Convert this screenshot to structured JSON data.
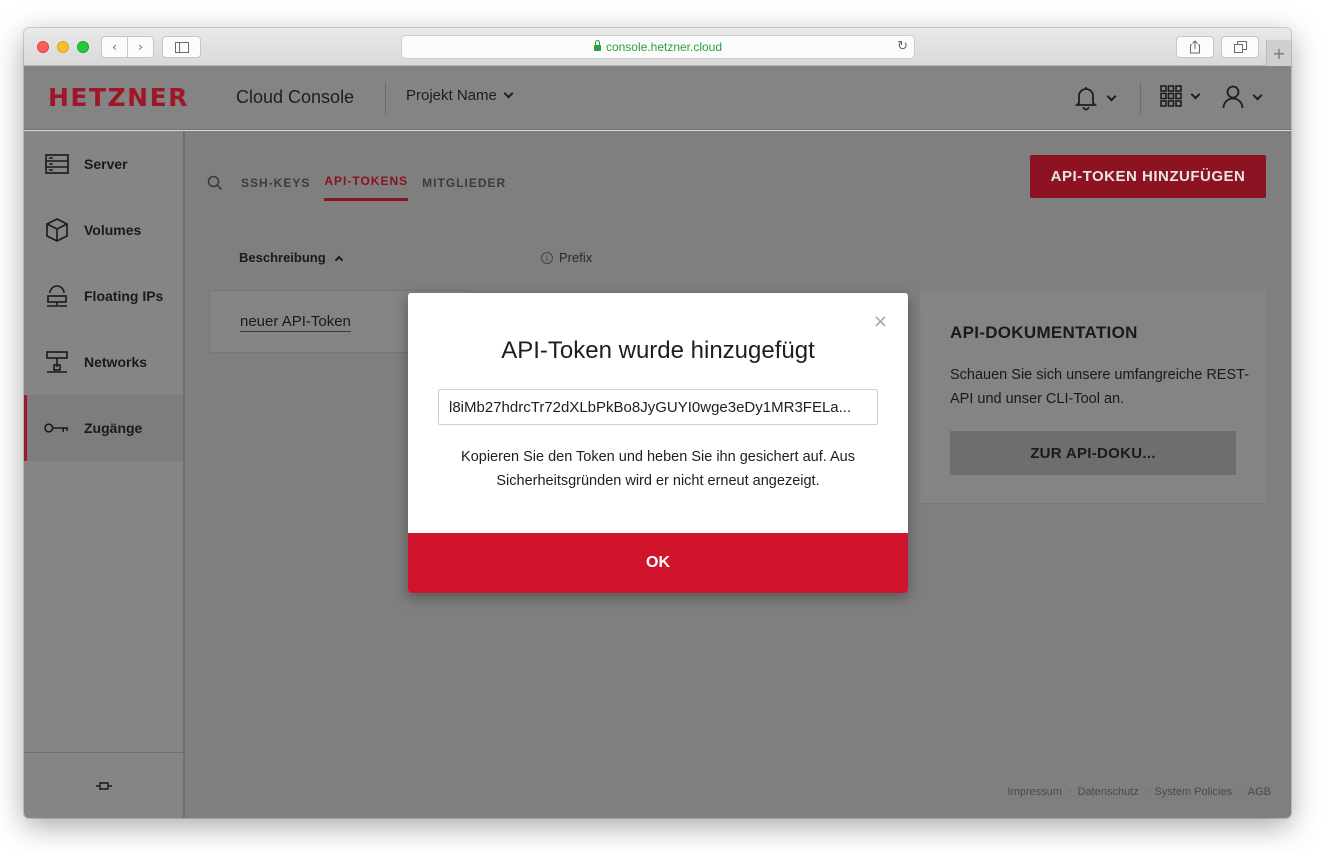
{
  "browser": {
    "url": "console.hetzner.cloud",
    "nav_back": "‹",
    "nav_forward": "›",
    "reload": "↻",
    "new_tab": "+"
  },
  "header": {
    "logo": "HETZNER",
    "app_name": "Cloud Console",
    "project": "Projekt Name"
  },
  "sidebar": {
    "items": [
      {
        "label": "Server",
        "icon": "server-icon"
      },
      {
        "label": "Volumes",
        "icon": "volume-icon"
      },
      {
        "label": "Floating IPs",
        "icon": "floating-ip-icon"
      },
      {
        "label": "Networks",
        "icon": "network-icon"
      },
      {
        "label": "Zugänge",
        "icon": "key-icon",
        "active": true
      }
    ],
    "pin_icon": "pin-icon"
  },
  "main": {
    "tabs": [
      {
        "label": "SSH-KEYS"
      },
      {
        "label": "API-TOKENS",
        "active": true
      },
      {
        "label": "MITGLIEDER"
      }
    ],
    "add_button": "API-TOKEN HINZUFÜGEN",
    "columns": {
      "description": "Beschreibung",
      "prefix": "Prefix"
    },
    "rows": [
      {
        "description": "neuer API-Token"
      }
    ],
    "doc_card": {
      "title": "API-DOKUMENTATION",
      "text": "Schauen Sie sich unsere umfangreiche REST-API und unser CLI-Tool an.",
      "button": "ZUR API-DOKU..."
    },
    "footer": [
      "Impressum",
      "Datenschutz",
      "System Policies",
      "AGB"
    ]
  },
  "modal": {
    "title": "API-Token wurde hinzugefügt",
    "token": "l8iMb27hdrcTr72dXLbPkBo8JyGUYI0wge3eDy1MR3FELa...",
    "text": "Kopieren Sie den Token und heben Sie ihn gesichert auf. Aus Sicherheitsgründen wird er nicht erneut angezeigt.",
    "ok": "OK",
    "close": "×"
  },
  "colors": {
    "brand_red": "#d0142c",
    "dimmed_brand": "#8d1322"
  }
}
